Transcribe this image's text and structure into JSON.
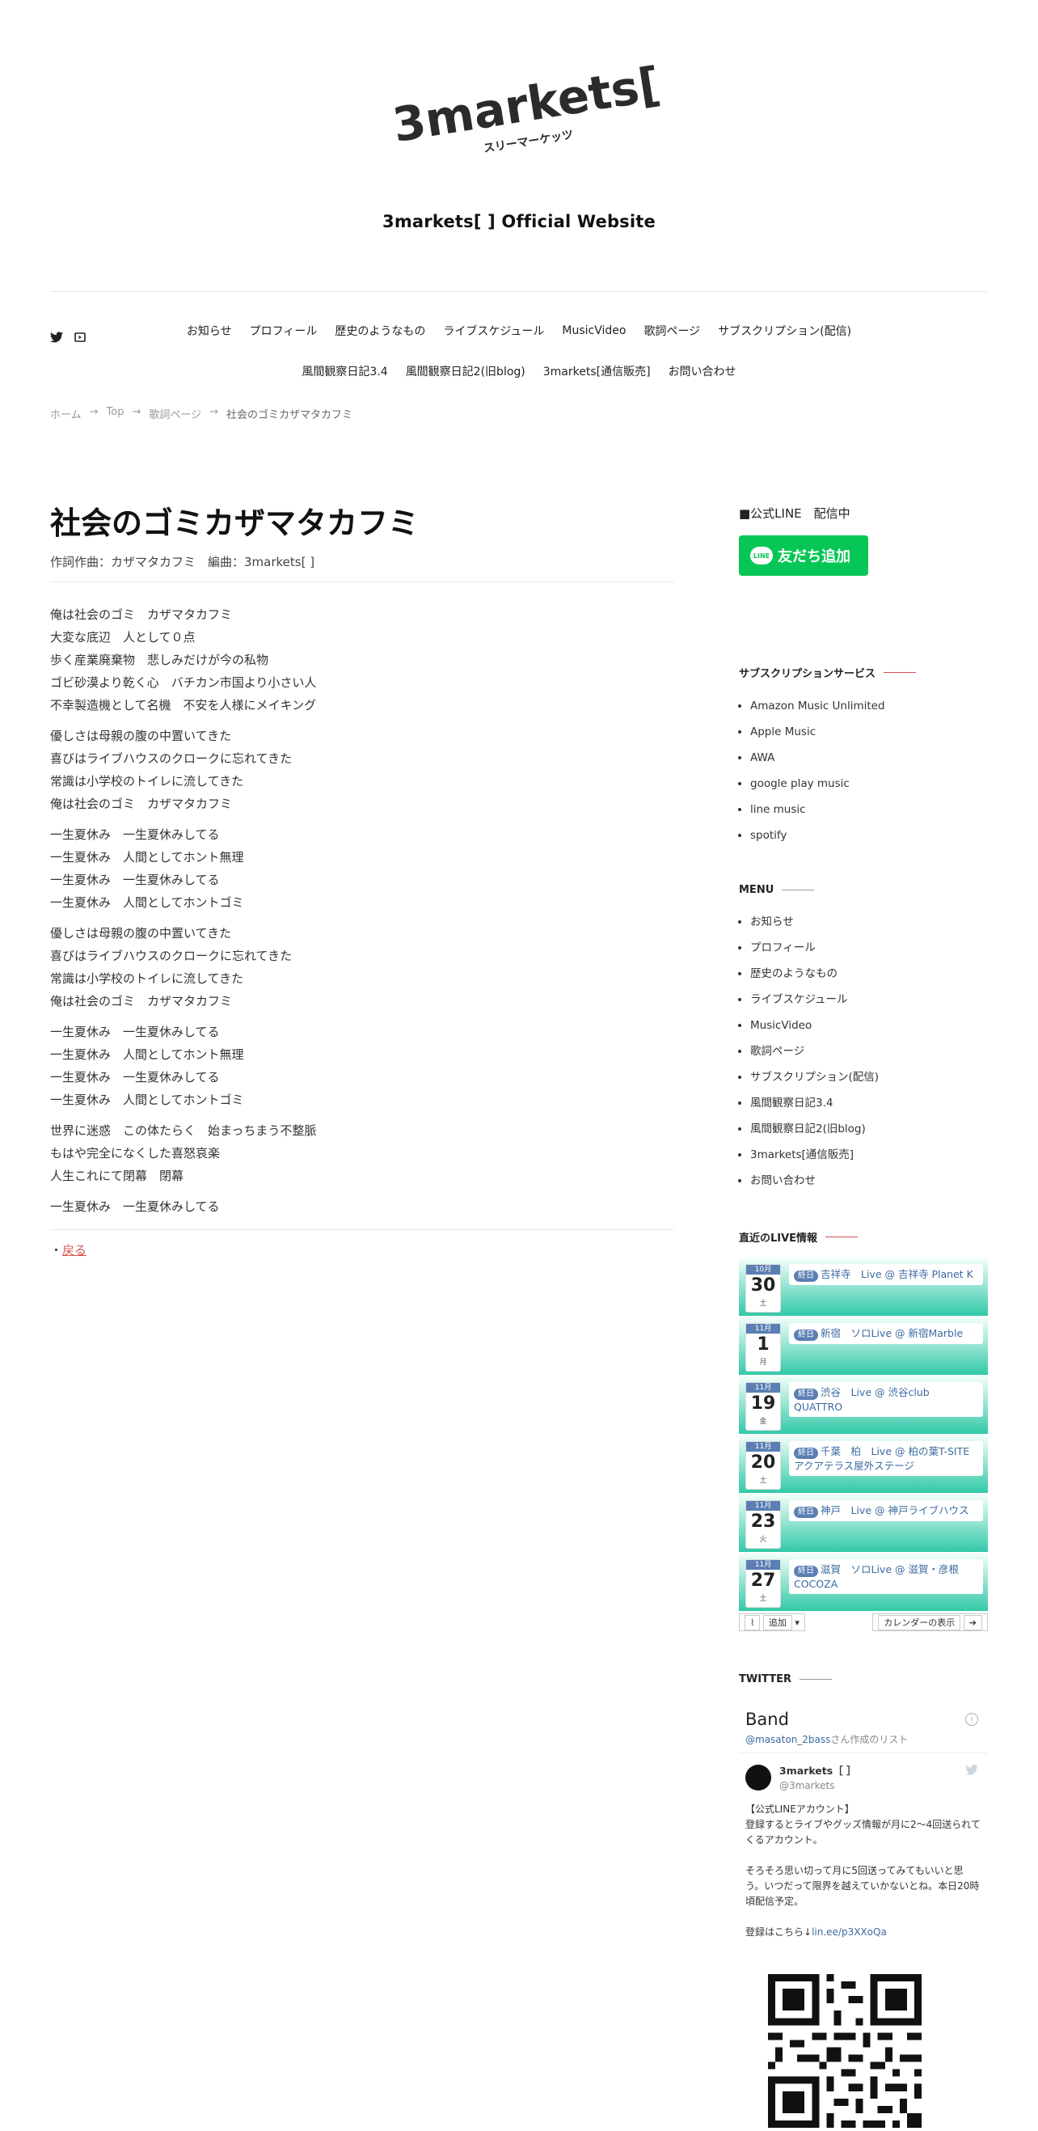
{
  "header": {
    "logo_text": "3markets[ ]",
    "logo_kana": "スリーマーケッツ",
    "site_title": "3markets[ ] Official Website"
  },
  "nav": {
    "row1": [
      "お知らせ",
      "プロフィール",
      "歴史のようなもの",
      "ライブスケジュール",
      "MusicVideo",
      "歌詞ページ",
      "サブスクリプション(配信)"
    ],
    "row2": [
      "風間観察日記3.4",
      "風間観察日記2(旧blog)",
      "3markets[通信販売]",
      "お問い合わせ"
    ]
  },
  "breadcrumb": {
    "home": "ホーム",
    "sep": "→",
    "top": "Top",
    "lyrics": "歌詞ページ",
    "current": "社会のゴミカザマタカフミ"
  },
  "main": {
    "title": "社会のゴミカザマタカフミ",
    "credit": "作詞作曲：カザマタカフミ　編曲：3markets[ ]",
    "stanzas": [
      [
        "俺は社会のゴミ　カザマタカフミ",
        "大変な底辺　人として０点",
        "歩く産業廃棄物　悲しみだけが今の私物",
        "ゴビ砂漠より乾く心　バチカン市国より小さい人",
        "不幸製造機として名機　不安を人様にメイキング"
      ],
      [
        "優しさは母親の腹の中置いてきた",
        "喜びはライブハウスのクロークに忘れてきた",
        "常識は小学校のトイレに流してきた",
        "俺は社会のゴミ　カザマタカフミ"
      ],
      [
        "一生夏休み　一生夏休みしてる",
        "一生夏休み　人間としてホント無理",
        "一生夏休み　一生夏休みしてる",
        "一生夏休み　人間としてホントゴミ"
      ],
      [
        "優しさは母親の腹の中置いてきた",
        "喜びはライブハウスのクロークに忘れてきた",
        "常識は小学校のトイレに流してきた",
        "俺は社会のゴミ　カザマタカフミ"
      ],
      [
        "一生夏休み　一生夏休みしてる",
        "一生夏休み　人間としてホント無理",
        "一生夏休み　一生夏休みしてる",
        "一生夏休み　人間としてホントゴミ"
      ],
      [
        "世界に迷惑　この体たらく　始まっちまう不整脈",
        "もはや完全になくした喜怒哀楽",
        "人生これにて閉幕　閉幕"
      ],
      [
        "一生夏休み　一生夏休みしてる"
      ]
    ],
    "back_prefix": "・",
    "back_label": "戻る"
  },
  "sidebar": {
    "line_label": "■公式LINE　配信中",
    "line_button": "友だち追加",
    "line_bubble": "LINE",
    "subs_title": "サブスクリプションサービス",
    "subs": [
      "Amazon Music Unlimited",
      "Apple Music",
      "AWA",
      "google play music",
      "line music",
      "spotify"
    ],
    "menu_title": "MENU",
    "menu": [
      "お知らせ",
      "プロフィール",
      "歴史のようなもの",
      "ライブスケジュール",
      "MusicVideo",
      "歌詞ページ",
      "サブスクリプション(配信)",
      "風間観察日記3.4",
      "風間観察日記2(旧blog)",
      "3markets[通信販売]",
      "お問い合わせ"
    ],
    "live_title": "直近のLIVE情報",
    "live": [
      {
        "month": "10月",
        "day": "30",
        "wd": "土",
        "badge": "終日",
        "text": "吉祥寺　Live @ 吉祥寺 Planet K"
      },
      {
        "month": "11月",
        "day": "1",
        "wd": "月",
        "badge": "終日",
        "text": "新宿　ソロLive @ 新宿Marble"
      },
      {
        "month": "11月",
        "day": "19",
        "wd": "金",
        "badge": "終日",
        "text": "渋谷　Live @ 渋谷club QUATTRO"
      },
      {
        "month": "11月",
        "day": "20",
        "wd": "土",
        "badge": "終日",
        "text": "千葉　柏　Live @ 柏の葉T-SITE　アクアテラス屋外ステージ"
      },
      {
        "month": "11月",
        "day": "23",
        "wd": "火",
        "badge": "終日",
        "text": "神戸　Live @ 神戸ライブハウス"
      },
      {
        "month": "11月",
        "day": "27",
        "wd": "土",
        "badge": "終日",
        "text": "滋賀　ソロLive @ 滋賀・彦根 COCOZA"
      }
    ],
    "live_add": "追加",
    "live_calendar": "カレンダーの表示",
    "twitter_title": "TWITTER",
    "tw_list_title": "Band",
    "tw_list_owner": "@masaton_2bass",
    "tw_list_suffix": "さん作成のリスト",
    "tw_name": "3markets［ ］",
    "tw_handle": "@3markets",
    "tw_text1": "【公式LINEアカウント】",
    "tw_text2": "登録するとライブやグッズ情報が月に2〜4回送られてくるアカウント。",
    "tw_text3": "そろそろ思い切って月に5回送ってみてもいいと思う。いつだって限界を越えていかないとね。本日20時頃配信予定。",
    "tw_text4": "登録はこちら↓",
    "tw_link": "lin.ee/p3XXoQa"
  }
}
